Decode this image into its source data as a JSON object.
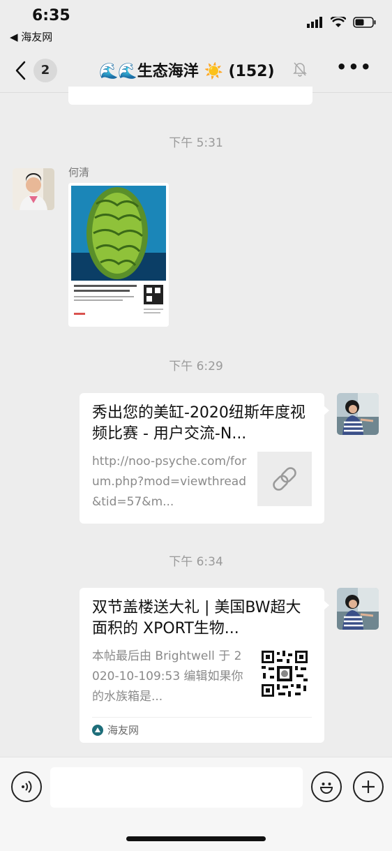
{
  "status_bar": {
    "time": "6:35",
    "back_app": "◀ 海友网"
  },
  "nav": {
    "unread_count": "2",
    "title": "🌊🌊生态海洋 ☀️ (152)"
  },
  "messages": [
    {
      "timestamp": "下午 5:31"
    },
    {
      "sender": "何清",
      "type": "image"
    },
    {
      "timestamp": "下午 6:29"
    },
    {
      "type": "link",
      "title": "秀出您的美缸-2020纽斯年度视频比赛 - 用户交流-N...",
      "description": "http://noo-psyche.com/forum.php?mod=viewthread&tid=57&m..."
    },
    {
      "timestamp": "下午 6:34"
    },
    {
      "type": "link",
      "title": "双节盖楼送大礼 | 美国BW超大面积的 XPORT生物...",
      "description": "本帖最后由 Brightwell 于 2020-10-109:53 编辑如果你的水族箱是...",
      "source": "海友网"
    }
  ],
  "input_bar": {
    "placeholder": ""
  },
  "colors": {
    "background": "#ededed",
    "card": "#ffffff",
    "timestamp": "#9a9a9a"
  }
}
